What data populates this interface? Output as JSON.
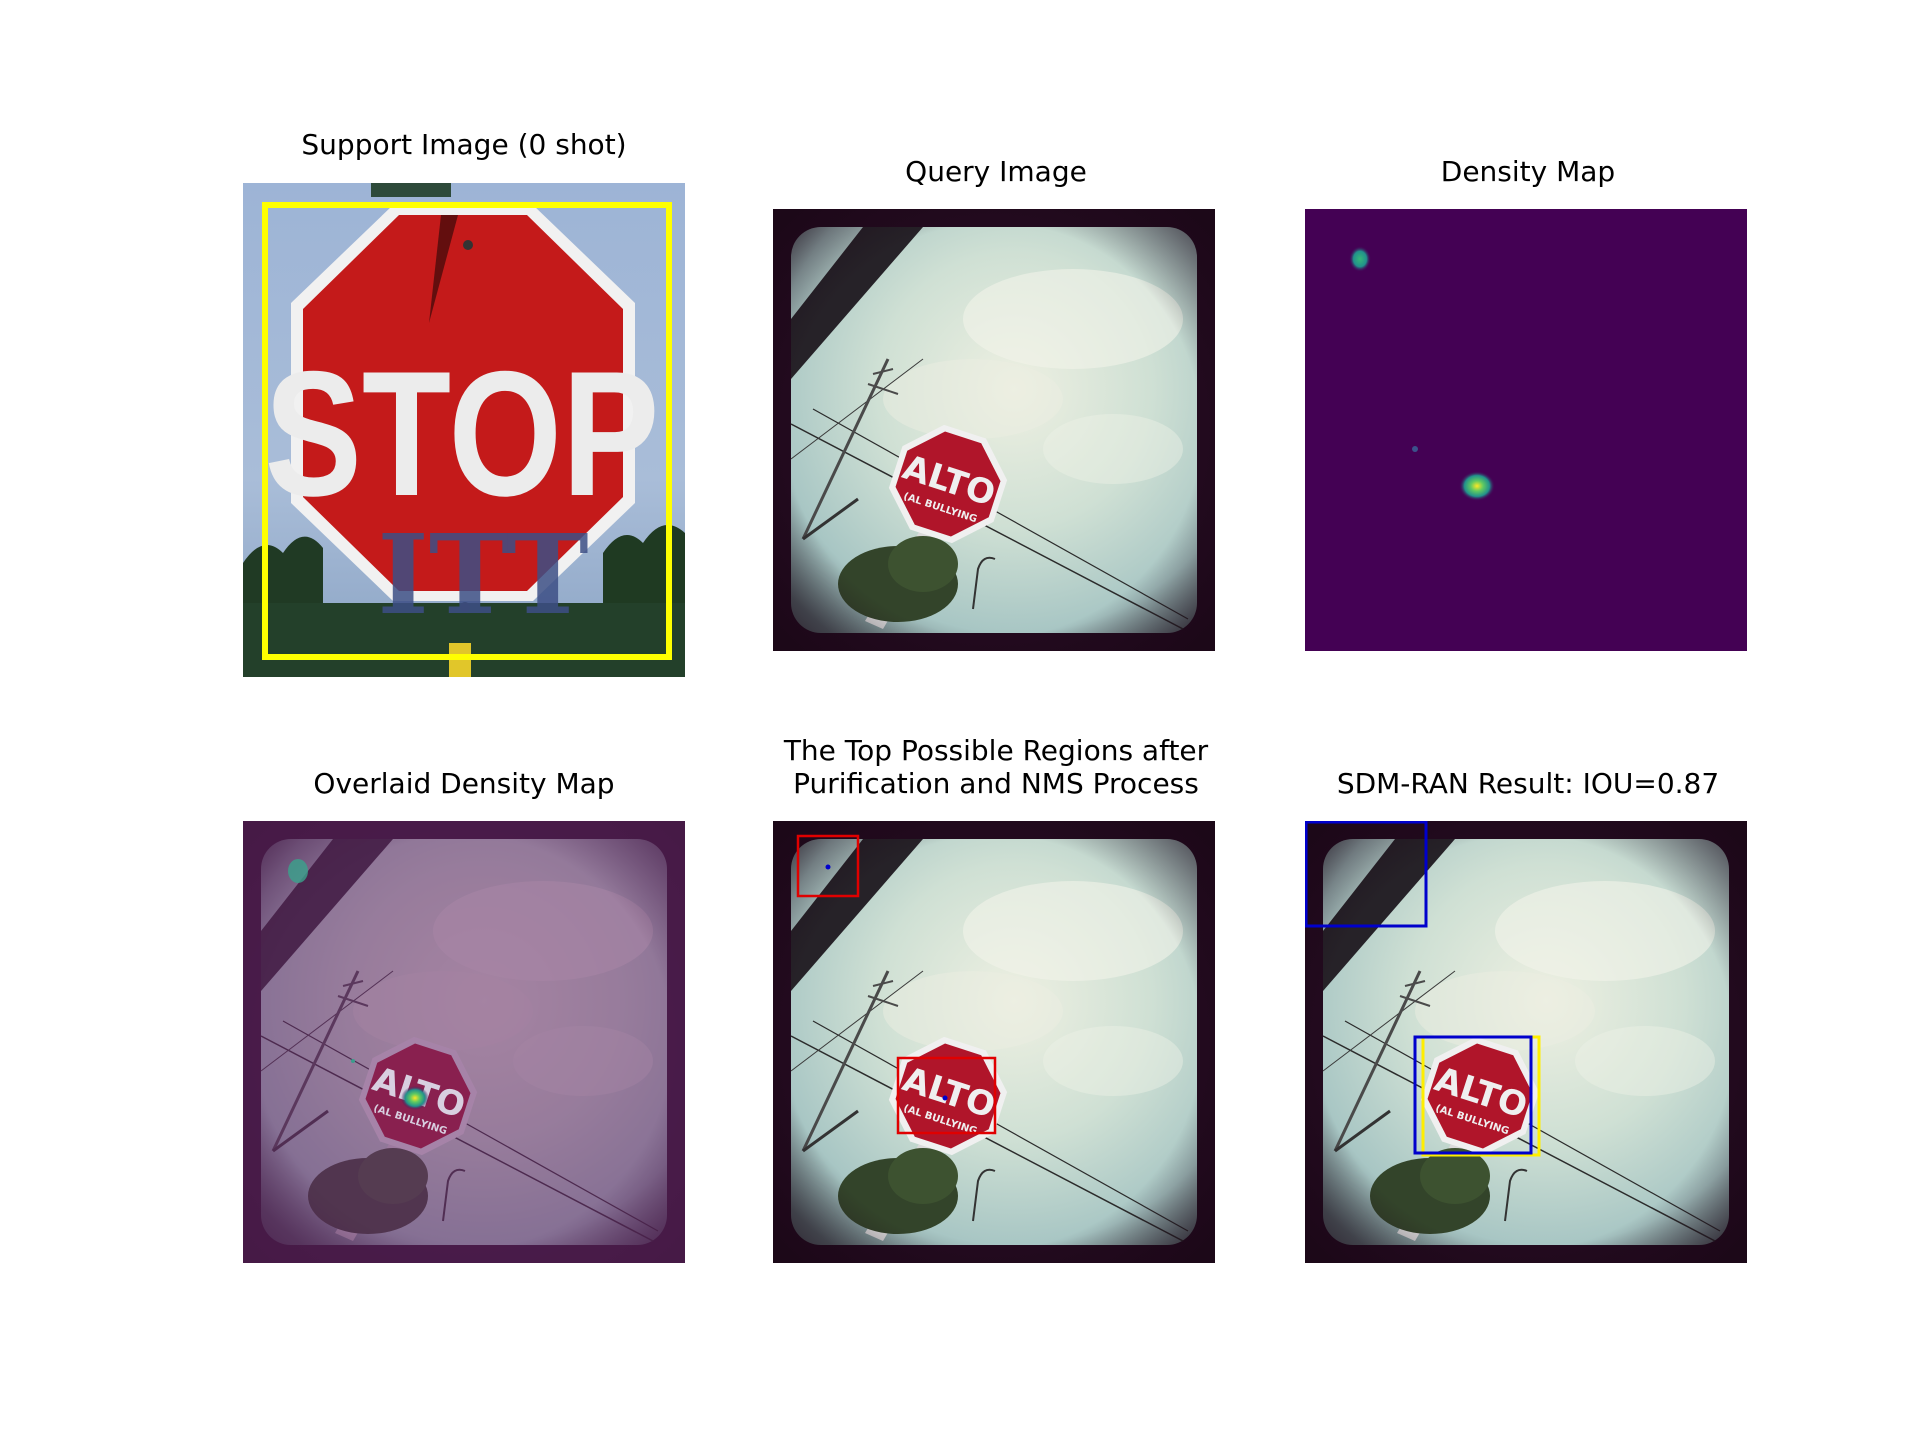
{
  "figure": {
    "panels": [
      {
        "id": "support",
        "title": "Support Image (0 shot)",
        "sign_text": "STOP",
        "graffiti": "ITT"
      },
      {
        "id": "query",
        "title": "Query Image",
        "sign_text": "ALTO",
        "sign_subtext": "(AL BULLYING"
      },
      {
        "id": "density",
        "title": "Density Map",
        "colormap": "viridis"
      },
      {
        "id": "overlay",
        "title": "Overlaid Density Map",
        "sign_text": "ALTO",
        "sign_subtext": "(AL BULLYING"
      },
      {
        "id": "regions",
        "title": "The Top Possible Regions after\nPurification and NMS Process",
        "sign_text": "ALTO",
        "sign_subtext": "(AL BULLYING"
      },
      {
        "id": "result",
        "title": "SDM-RAN Result: IOU=0.87",
        "sign_text": "ALTO",
        "sign_subtext": "(AL BULLYING"
      }
    ],
    "colors": {
      "support_box": "#ffff00",
      "candidate_box": "#e00000",
      "predicted_box": "#0000cc",
      "ground_truth_box": "#ffee00",
      "density_background": "#440154",
      "sign_red": "#c41a1a"
    }
  }
}
